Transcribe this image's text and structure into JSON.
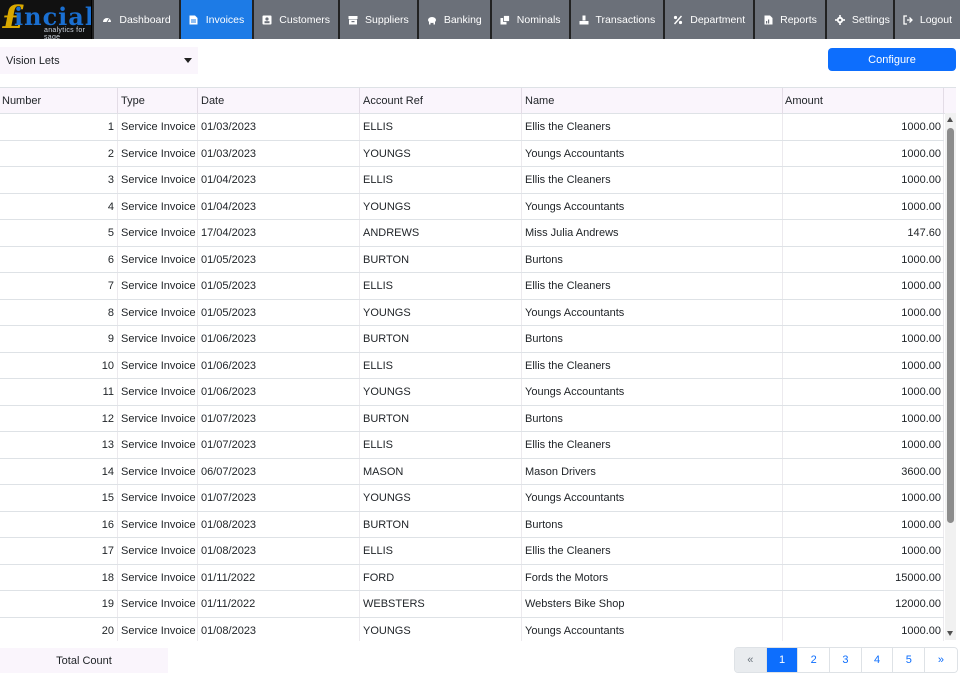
{
  "brand": {
    "word": "incial",
    "tagline": "analytics for sage"
  },
  "nav": {
    "items": [
      {
        "label": "Dashboard",
        "icon": "dashboard-icon",
        "active": false
      },
      {
        "label": "Invoices",
        "icon": "invoice-icon",
        "active": true
      },
      {
        "label": "Customers",
        "icon": "customers-icon",
        "active": false
      },
      {
        "label": "Suppliers",
        "icon": "suppliers-icon",
        "active": false
      },
      {
        "label": "Banking",
        "icon": "bank-icon",
        "active": false
      },
      {
        "label": "Nominals",
        "icon": "nominals-icon",
        "active": false
      },
      {
        "label": "Transactions",
        "icon": "transactions-icon",
        "active": false
      },
      {
        "label": "Department",
        "icon": "percent-icon",
        "active": false
      },
      {
        "label": "Reports",
        "icon": "reports-icon",
        "active": false
      }
    ],
    "right": [
      {
        "label": "Settings",
        "icon": "gear-icon"
      },
      {
        "label": "Logout",
        "icon": "logout-icon"
      }
    ]
  },
  "company_select": {
    "value": "Vision Lets"
  },
  "configure_label": "Configure",
  "table": {
    "columns": [
      "Number",
      "Type",
      "Date",
      "Account Ref",
      "Name",
      "Amount"
    ],
    "rows": [
      [
        "1",
        "Service Invoice",
        "01/03/2023",
        "ELLIS",
        "Ellis the Cleaners",
        "1000.00"
      ],
      [
        "2",
        "Service Invoice",
        "01/03/2023",
        "YOUNGS",
        "Youngs Accountants",
        "1000.00"
      ],
      [
        "3",
        "Service Invoice",
        "01/04/2023",
        "ELLIS",
        "Ellis the Cleaners",
        "1000.00"
      ],
      [
        "4",
        "Service Invoice",
        "01/04/2023",
        "YOUNGS",
        "Youngs Accountants",
        "1000.00"
      ],
      [
        "5",
        "Service Invoice",
        "17/04/2023",
        "ANDREWS",
        "Miss Julia Andrews",
        "147.60"
      ],
      [
        "6",
        "Service Invoice",
        "01/05/2023",
        "BURTON",
        "Burtons",
        "1000.00"
      ],
      [
        "7",
        "Service Invoice",
        "01/05/2023",
        "ELLIS",
        "Ellis the Cleaners",
        "1000.00"
      ],
      [
        "8",
        "Service Invoice",
        "01/05/2023",
        "YOUNGS",
        "Youngs Accountants",
        "1000.00"
      ],
      [
        "9",
        "Service Invoice",
        "01/06/2023",
        "BURTON",
        "Burtons",
        "1000.00"
      ],
      [
        "10",
        "Service Invoice",
        "01/06/2023",
        "ELLIS",
        "Ellis the Cleaners",
        "1000.00"
      ],
      [
        "11",
        "Service Invoice",
        "01/06/2023",
        "YOUNGS",
        "Youngs Accountants",
        "1000.00"
      ],
      [
        "12",
        "Service Invoice",
        "01/07/2023",
        "BURTON",
        "Burtons",
        "1000.00"
      ],
      [
        "13",
        "Service Invoice",
        "01/07/2023",
        "ELLIS",
        "Ellis the Cleaners",
        "1000.00"
      ],
      [
        "14",
        "Service Invoice",
        "06/07/2023",
        "MASON",
        "Mason Drivers",
        "3600.00"
      ],
      [
        "15",
        "Service Invoice",
        "01/07/2023",
        "YOUNGS",
        "Youngs Accountants",
        "1000.00"
      ],
      [
        "16",
        "Service Invoice",
        "01/08/2023",
        "BURTON",
        "Burtons",
        "1000.00"
      ],
      [
        "17",
        "Service Invoice",
        "01/08/2023",
        "ELLIS",
        "Ellis the Cleaners",
        "1000.00"
      ],
      [
        "18",
        "Service Invoice",
        "01/11/2022",
        "FORD",
        "Fords the Motors",
        "15000.00"
      ],
      [
        "19",
        "Service Invoice",
        "01/11/2022",
        "WEBSTERS",
        "Websters Bike Shop",
        "12000.00"
      ],
      [
        "20",
        "Service Invoice",
        "01/08/2023",
        "YOUNGS",
        "Youngs Accountants",
        "1000.00"
      ]
    ]
  },
  "footer": {
    "total_count_label": "Total Count",
    "pagination": [
      "«",
      "1",
      "2",
      "3",
      "4",
      "5",
      "»"
    ],
    "current_page": "1"
  },
  "colors": {
    "nav_bg": "#6b7079",
    "nav_active": "#1d7be6",
    "primary": "#0d6efd"
  }
}
